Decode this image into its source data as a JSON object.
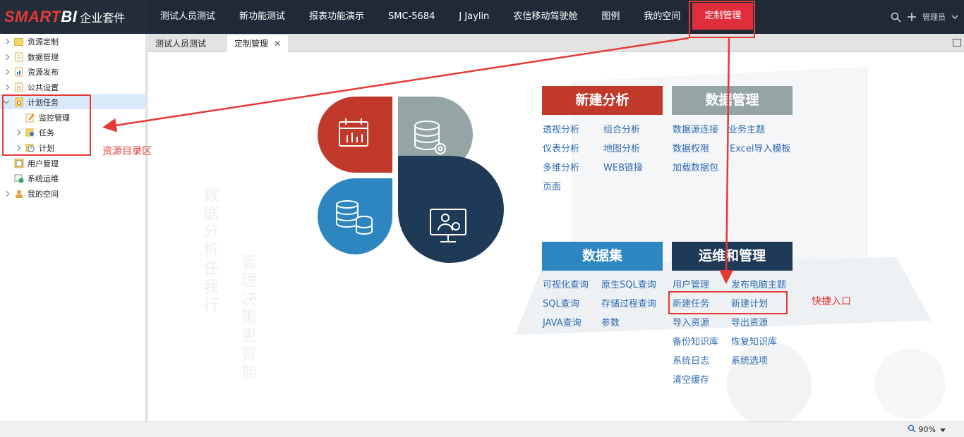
{
  "brand": {
    "logo_colored": "SMART",
    "logo_white": "BI",
    "suffix": "企业套件"
  },
  "nav": {
    "items": [
      "测试人员测试",
      "新功能测试",
      "报表功能演示",
      "SMC-5684",
      "J Jaylin",
      "农信移动驾驶舱",
      "图例",
      "我的空间",
      "定制管理"
    ],
    "active_index": 8,
    "user_label": "管理员"
  },
  "sidebar": {
    "items": [
      {
        "label": "资源定制",
        "icon": "folder-icon"
      },
      {
        "label": "数据管理",
        "icon": "data-icon"
      },
      {
        "label": "资源发布",
        "icon": "publish-icon"
      },
      {
        "label": "公共设置",
        "icon": "settings-icon"
      },
      {
        "label": "计划任务",
        "icon": "schedule-icon"
      },
      {
        "label": "监控管理",
        "icon": "monitor-icon"
      },
      {
        "label": "任务",
        "icon": "task-icon"
      },
      {
        "label": "计划",
        "icon": "clock-icon"
      },
      {
        "label": "用户管理",
        "icon": "user-manage-icon"
      },
      {
        "label": "系统运维",
        "icon": "system-icon"
      },
      {
        "label": "我的空间",
        "icon": "person-icon"
      }
    ],
    "selected_index": 4
  },
  "tabs": {
    "items": [
      "测试人员测试",
      "定制管理"
    ],
    "active_index": 1,
    "close_glyph": "✕"
  },
  "background_text": {
    "col1": "数据分析任我行",
    "col2": "管理决策更智能"
  },
  "cards": {
    "new_analysis": {
      "title": "新建分析",
      "links": [
        "透视分析",
        "组合分析",
        "仪表分析",
        "地图分析",
        "多维分析",
        "WEB链接",
        "页面"
      ]
    },
    "data_management": {
      "title": "数据管理",
      "links": [
        "数据源连接",
        "业务主题",
        "数据权限",
        "Excel导入模板",
        "加载数据包"
      ]
    },
    "dataset": {
      "title": "数据集",
      "links": [
        "可视化查询",
        "原生SQL查询",
        "SQL查询",
        "存储过程查询",
        "JAVA查询",
        "参数"
      ]
    },
    "ops": {
      "title": "运维和管理",
      "links": [
        "用户管理",
        "发布电脑主题",
        "新建任务",
        "新建计划",
        "导入资源",
        "导出资源",
        "备份知识库",
        "恢复知识库",
        "系统日志",
        "系统选项",
        "清空缓存"
      ]
    }
  },
  "annotations": {
    "resource_area": "资源目录区",
    "quick_entry": "快捷入口"
  },
  "status": {
    "zoom": "90%"
  },
  "colors": {
    "nav_bg": "#1f2a36",
    "active_red": "#e02e3c",
    "card_red": "#c0392b",
    "card_gray": "#95a5a6",
    "card_blue": "#2e86c1",
    "card_navy": "#1f3a56",
    "link_blue": "#2f6ab0",
    "annotation_red": "#e53935"
  }
}
